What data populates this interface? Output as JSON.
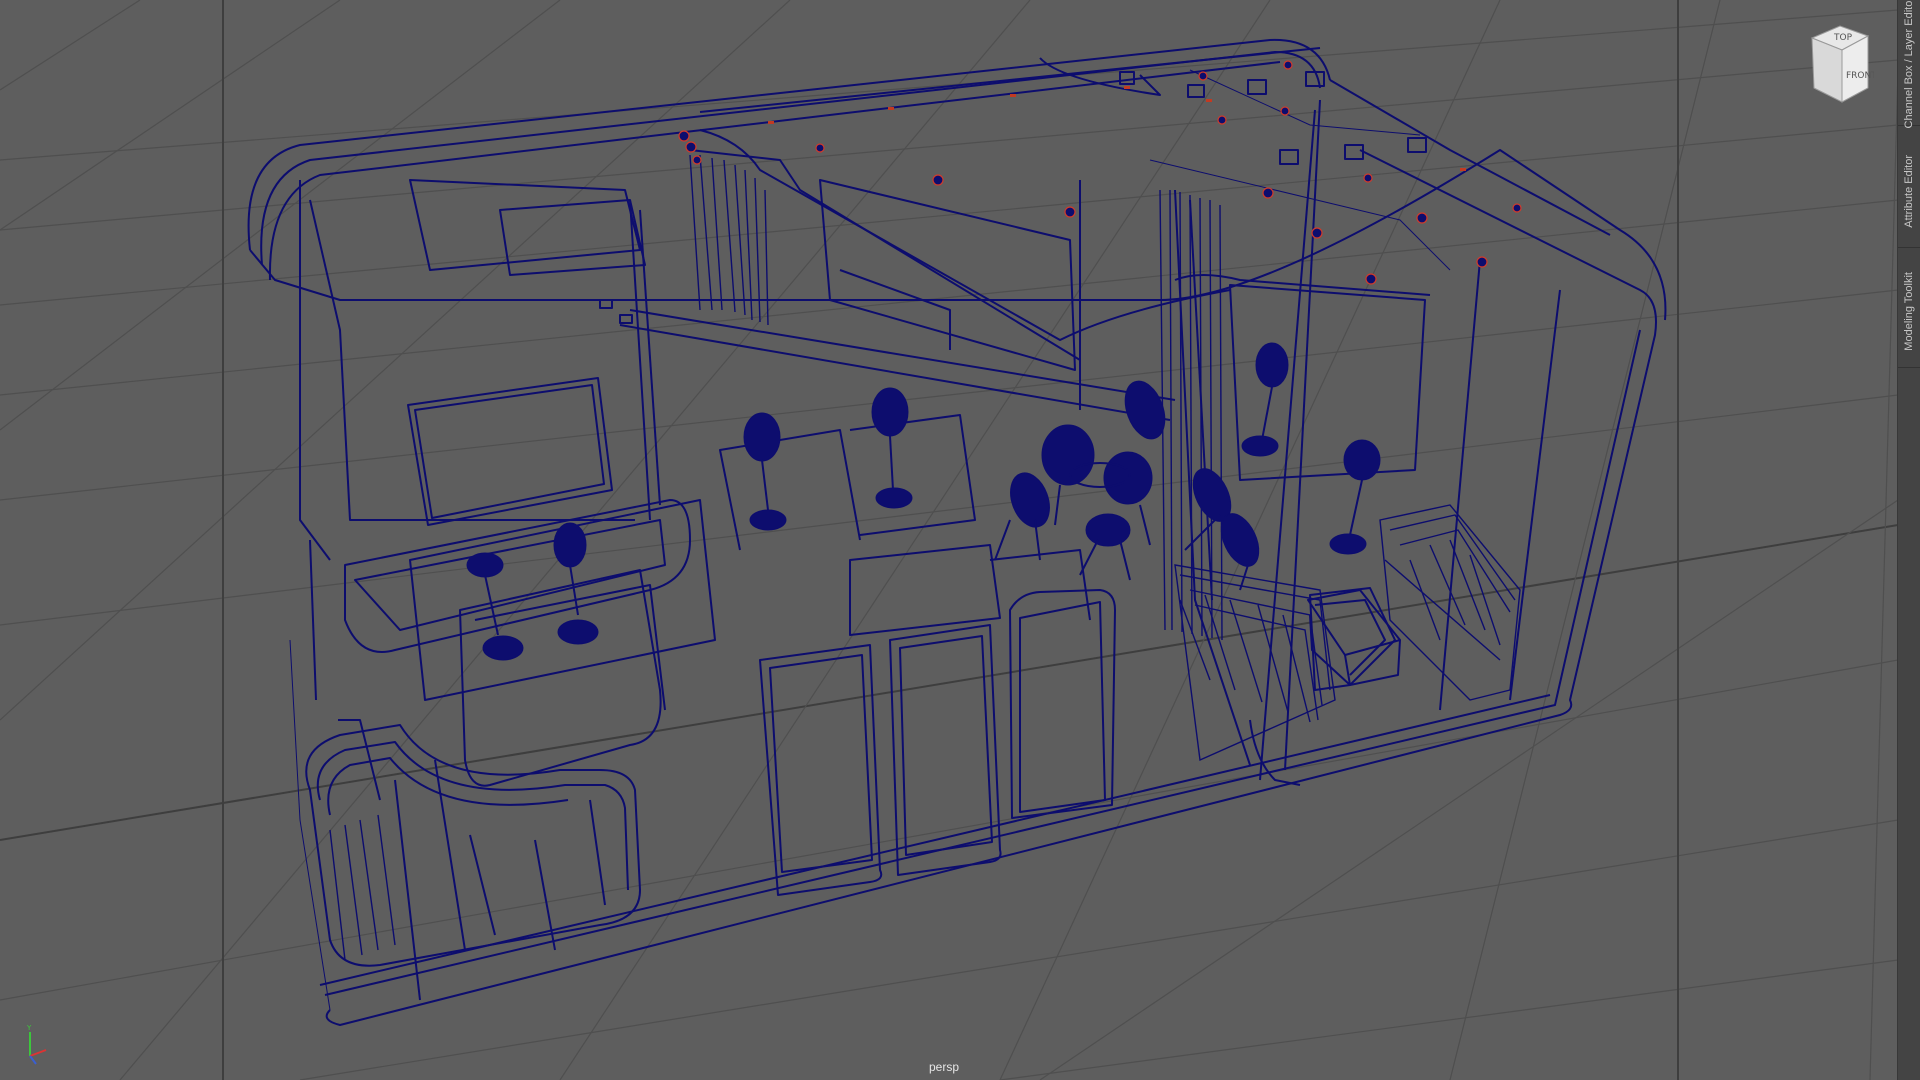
{
  "viewport": {
    "camera": "persp",
    "view_cube_face": "FRONT",
    "view_cube_top": "TOP"
  },
  "side_panel": {
    "tabs": [
      {
        "label": "Channel Box / Layer Editor"
      },
      {
        "label": "Attribute Editor"
      },
      {
        "label": "Modeling Toolkit"
      }
    ]
  },
  "axis_gizmo": {
    "y": "Y",
    "x": "X",
    "z": "Z"
  },
  "colors": {
    "background": "#5e5e5e",
    "grid": "#4f4f4f",
    "wireframe": "#0d0d6e",
    "selection_marker": "#c23a22"
  },
  "icons": [
    "view-cube-icon",
    "axis-gizmo-icon"
  ]
}
